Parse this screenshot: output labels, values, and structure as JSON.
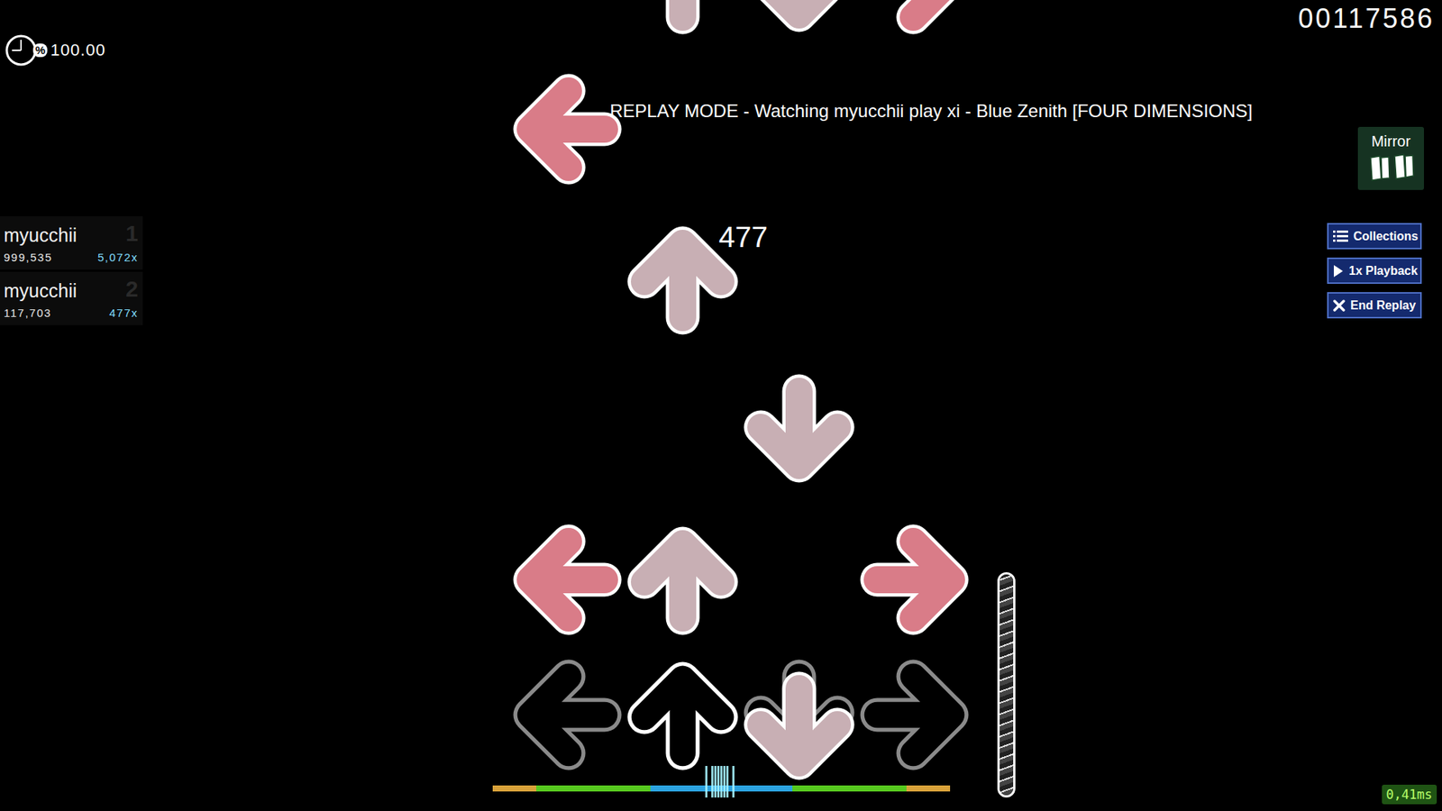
{
  "score": "00117586",
  "accuracy": {
    "symbol": "%",
    "value": "100.00"
  },
  "replay_banner": "REPLAY MODE - Watching myucchii play xi - Blue Zenith [FOUR DIMENSIONS]",
  "mod": {
    "name": "Mirror"
  },
  "buttons": [
    {
      "label": "Collections",
      "kind": "collections"
    },
    {
      "label": "1x Playback",
      "kind": "playback"
    },
    {
      "label": "End Replay",
      "kind": "end"
    }
  ],
  "leaderboard": [
    {
      "name": "myucchii",
      "rank": "1",
      "score": "999,535",
      "combo": "5,072x"
    },
    {
      "name": "myucchii",
      "rank": "2",
      "score": "117,703",
      "combo": "477x"
    }
  ],
  "combo": "477",
  "lanes": [
    {
      "direction": "left",
      "color": "#d97c88",
      "pressed": false,
      "notes": [
        0.9,
        3.9
      ]
    },
    {
      "direction": "up",
      "color": "#c8afb4",
      "pressed": true,
      "notes": [
        0.9,
        2.9,
        4.9
      ]
    },
    {
      "direction": "down",
      "color": "#c8afb4",
      "pressed": false,
      "notes": [
        -0.08,
        1.9,
        4.9
      ]
    },
    {
      "direction": "right",
      "color": "#d97c88",
      "pressed": false,
      "notes": [
        0.9,
        4.9
      ]
    }
  ],
  "hit_errors_ms": [
    -4,
    -2,
    -1,
    0,
    1,
    2,
    3,
    5
  ],
  "health": {
    "level": 1
  },
  "latency": "0,41ms"
}
